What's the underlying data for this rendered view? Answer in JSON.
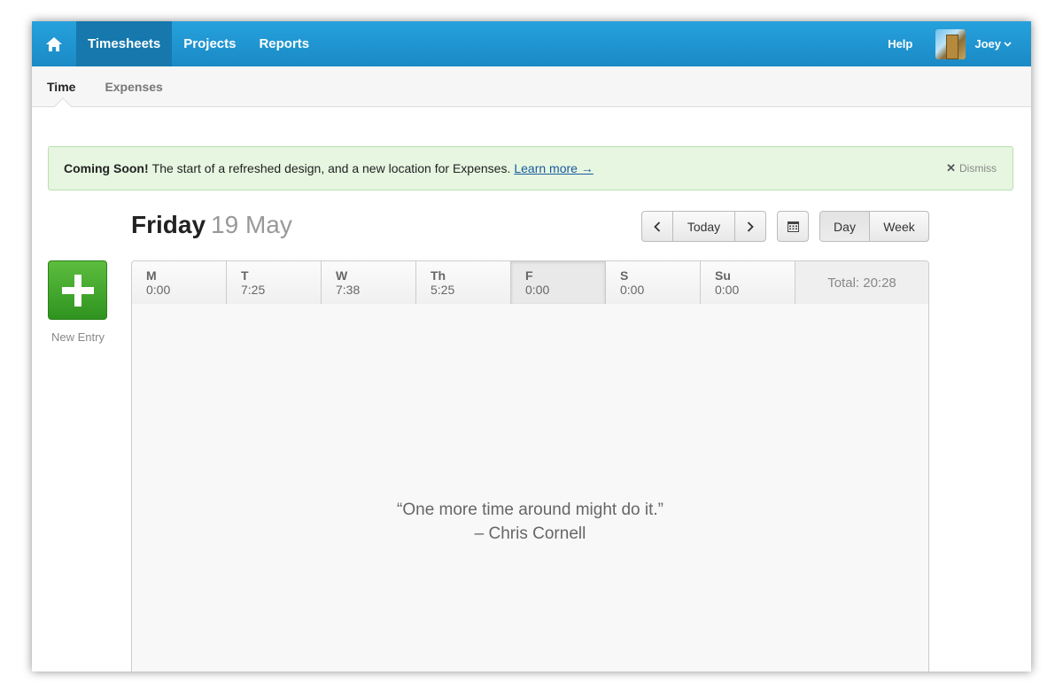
{
  "topnav": {
    "items": [
      {
        "label": "Timesheets",
        "active": true
      },
      {
        "label": "Projects",
        "active": false
      },
      {
        "label": "Reports",
        "active": false
      }
    ],
    "help_label": "Help",
    "user_label": "Joey",
    "colors": {
      "bar": "#2196d2",
      "active": "#1678ad"
    }
  },
  "subnav": {
    "items": [
      {
        "label": "Time",
        "active": true
      },
      {
        "label": "Expenses",
        "active": false
      }
    ]
  },
  "banner": {
    "headline": "Coming Soon!",
    "message": "The start of a refreshed design, and a new location for Expenses.",
    "link_label": "Learn more →",
    "dismiss_label": "Dismiss"
  },
  "date": {
    "weekday": "Friday",
    "date": "19 May"
  },
  "controls": {
    "today_label": "Today",
    "view_options": [
      {
        "label": "Day",
        "selected": true
      },
      {
        "label": "Week",
        "selected": false
      }
    ]
  },
  "new_entry": {
    "label": "New Entry",
    "color": "#3fa62a"
  },
  "week": {
    "days": [
      {
        "day": "M",
        "hours": "0:00",
        "current": false
      },
      {
        "day": "T",
        "hours": "7:25",
        "current": false
      },
      {
        "day": "W",
        "hours": "7:38",
        "current": false
      },
      {
        "day": "Th",
        "hours": "5:25",
        "current": false
      },
      {
        "day": "F",
        "hours": "0:00",
        "current": true
      },
      {
        "day": "S",
        "hours": "0:00",
        "current": false
      },
      {
        "day": "Su",
        "hours": "0:00",
        "current": false
      }
    ],
    "total_label": "Total: 20:28"
  },
  "empty_state": {
    "quote": "“One more time around might do it.”",
    "author": "– Chris Cornell"
  }
}
